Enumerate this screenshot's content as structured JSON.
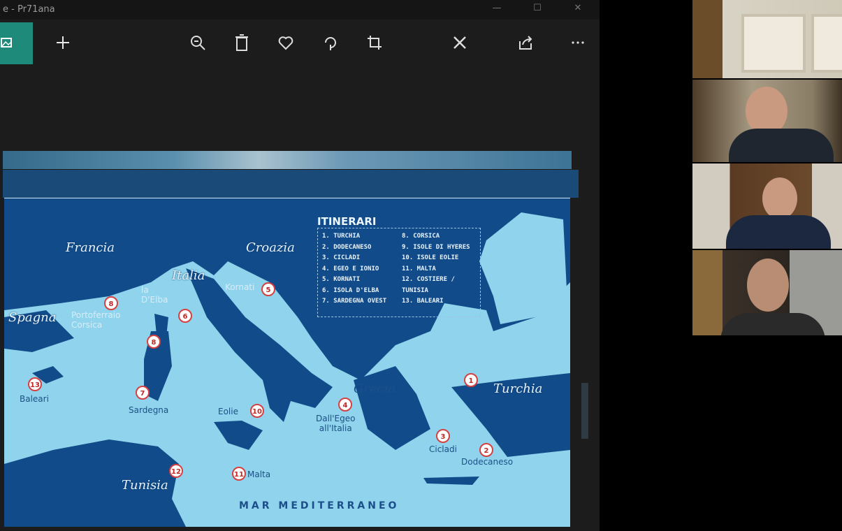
{
  "window": {
    "title": "e - Pr71ana"
  },
  "toolbar": {
    "buttons": [
      "home",
      "add",
      "zoom",
      "delete",
      "favorite",
      "rotate",
      "crop",
      "edit",
      "share",
      "more"
    ]
  },
  "map": {
    "countries": {
      "francia": "Francia",
      "spagna": "Spagna",
      "italia": "Italia",
      "croazia": "Croazia",
      "grecia": "Grecia",
      "turchia": "Turchia",
      "tunisia": "Tunisia"
    },
    "places": {
      "portoferraio": "Portoferraio\nCorsica",
      "elba": "la\nD'Elba",
      "kornati": "Kornati",
      "baleari": "Baleari",
      "sardegna": "Sardegna",
      "eolie": "Eolie",
      "ionio": "Dall'Egeo\nall'Italia",
      "cicladi": "Cicladi",
      "dodecaneso": "Dodecaneso",
      "malta": "Malta"
    },
    "sea": "MAR MEDITERRANEO",
    "legend": {
      "title": "ITINERARI",
      "left": [
        "1. TURCHIA",
        "2. DODECANESO",
        "3. CICLADI",
        "4. EGEO E IONIO",
        "5. KORNATI",
        "6. ISOLA D'ELBA",
        "7. SARDEGNA OVEST"
      ],
      "right": [
        "8. CORSICA",
        "9. ISOLE DI HYERES",
        "10. ISOLE EOLIE",
        "11. MALTA",
        "12. COSTIERE /",
        "   TUNISIA",
        "13. BALEARI"
      ]
    },
    "markers": [
      "8",
      "6",
      "5",
      "8",
      "13",
      "7",
      "10",
      "4",
      "1",
      "3",
      "2",
      "12",
      "11"
    ]
  },
  "colors": {
    "sea_dark": "#124b8a",
    "sea_light": "#8fd4ec",
    "accent": "#1e8a7a"
  },
  "participants": [
    "participant-1",
    "participant-2",
    "participant-3",
    "participant-4"
  ]
}
